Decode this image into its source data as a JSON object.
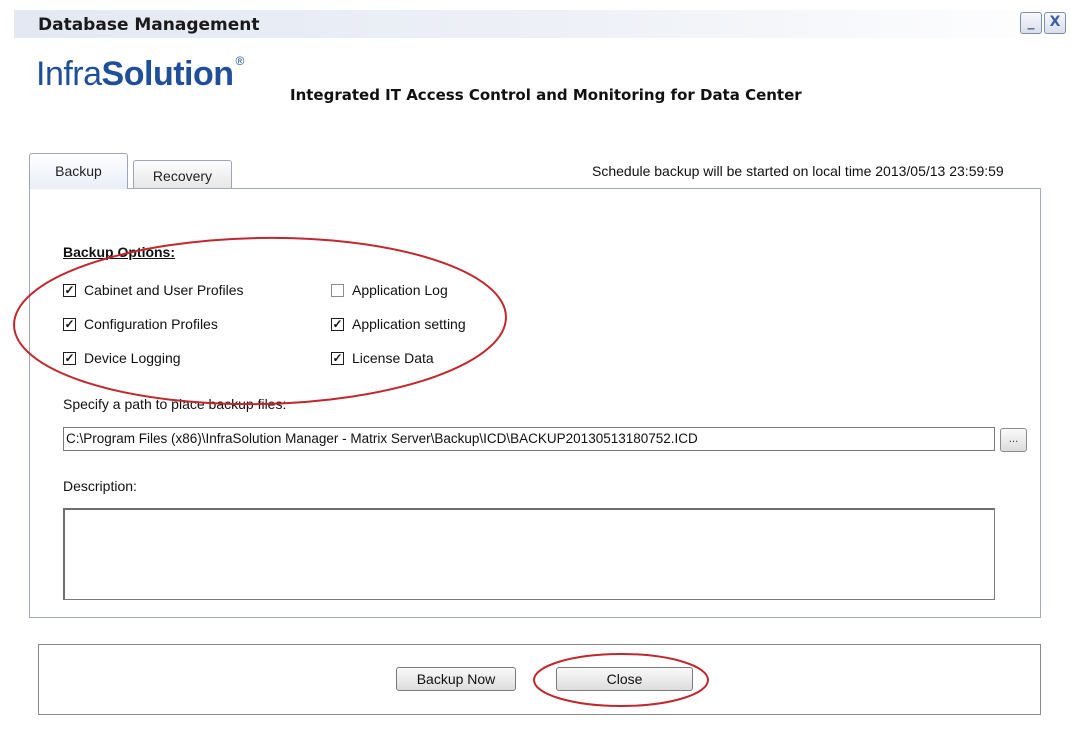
{
  "window": {
    "title": "Database Management",
    "minimize_glyph": "_",
    "close_glyph": "X"
  },
  "header": {
    "logo_part1": "Infra",
    "logo_part2": "Solution",
    "logo_mark": "®",
    "tagline": "Integrated IT Access Control and Monitoring for Data Center"
  },
  "tabs": [
    {
      "label": "Backup",
      "selected": true
    },
    {
      "label": "Recovery",
      "selected": false
    }
  ],
  "schedule_text": "Schedule backup will be started on local time 2013/05/13  23:59:59",
  "backup": {
    "options_heading": "Backup Options:",
    "options": [
      {
        "label": "Cabinet and User Profiles",
        "checked": true
      },
      {
        "label": "Configuration Profiles",
        "checked": true
      },
      {
        "label": "Device Logging",
        "checked": true
      },
      {
        "label": "Application Log",
        "checked": false
      },
      {
        "label": "Application setting",
        "checked": true
      },
      {
        "label": "License Data",
        "checked": true
      }
    ],
    "path_label": "Specify a path to place backup files:",
    "path_value": "C:\\Program Files (x86)\\InfraSolution Manager - Matrix Server\\Backup\\ICD\\BACKUP20130513180752.ICD",
    "browse_label": "...",
    "description_label": "Description:",
    "description_value": ""
  },
  "footer": {
    "backup_now_label": "Backup Now",
    "close_label": "Close"
  },
  "colors": {
    "annotation": "#c0282d",
    "logo": "#1f4e9a"
  }
}
